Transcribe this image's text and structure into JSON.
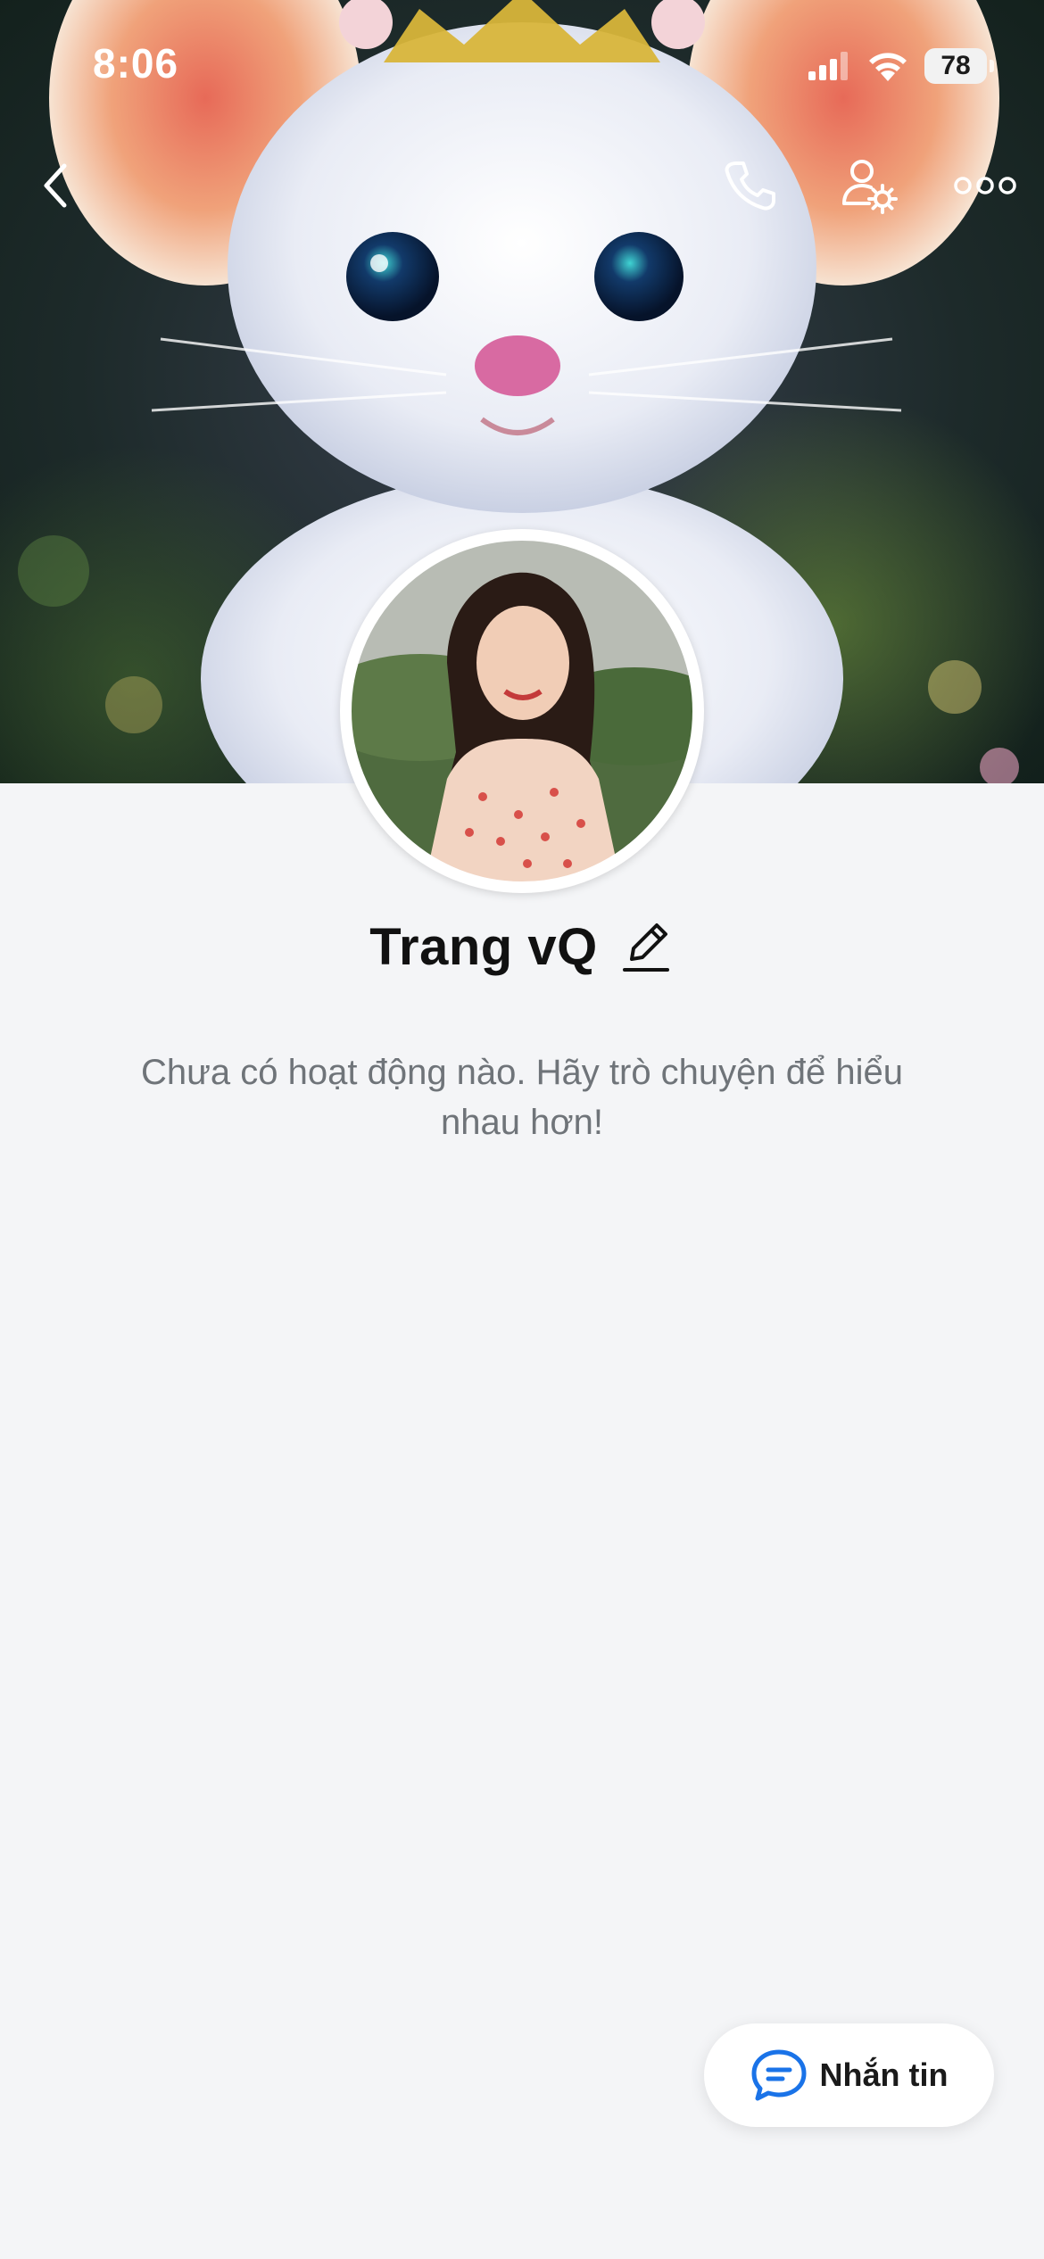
{
  "status_bar": {
    "time": "8:06",
    "battery": "78"
  },
  "nav": {
    "back_icon": "chevron-left-icon",
    "call_icon": "phone-icon",
    "settings_icon": "user-gear-icon",
    "more_icon": "more-horizontal-icon"
  },
  "profile": {
    "name": "Trang vQ",
    "edit_icon": "pencil-icon"
  },
  "feed": {
    "empty_message": "Chưa có hoạt động nào. Hãy trò chuyện để hiểu nhau hơn!"
  },
  "actions": {
    "message_label": "Nhắn tin",
    "message_icon": "chat-bubble-icon"
  },
  "colors": {
    "background": "#f4f5f7",
    "accent": "#1a73e8",
    "text_primary": "#111111",
    "text_secondary": "#6f7479"
  }
}
